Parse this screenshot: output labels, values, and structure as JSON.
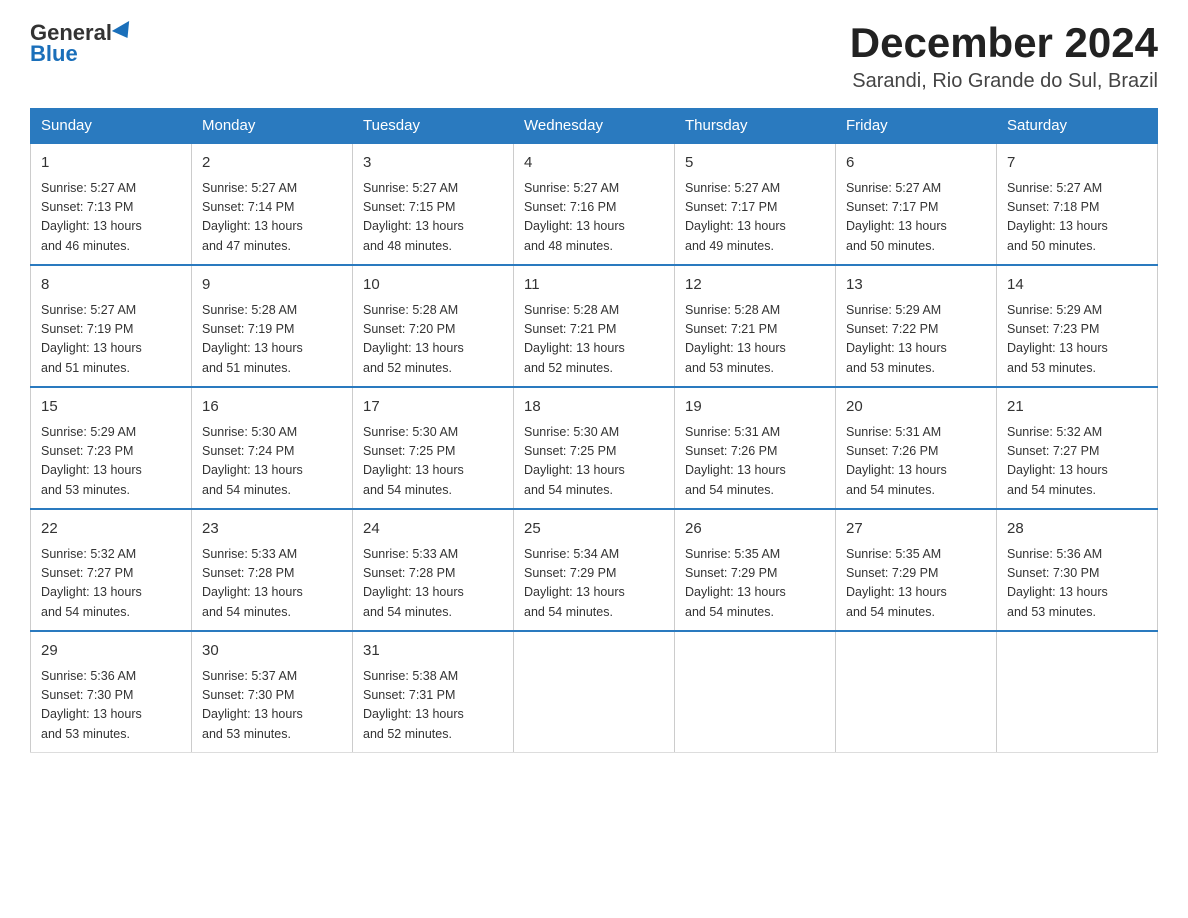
{
  "logo": {
    "general": "General",
    "blue": "Blue"
  },
  "title": "December 2024",
  "location": "Sarandi, Rio Grande do Sul, Brazil",
  "days_of_week": [
    "Sunday",
    "Monday",
    "Tuesday",
    "Wednesday",
    "Thursday",
    "Friday",
    "Saturday"
  ],
  "weeks": [
    [
      {
        "day": "1",
        "sunrise": "5:27 AM",
        "sunset": "7:13 PM",
        "daylight": "13 hours and 46 minutes."
      },
      {
        "day": "2",
        "sunrise": "5:27 AM",
        "sunset": "7:14 PM",
        "daylight": "13 hours and 47 minutes."
      },
      {
        "day": "3",
        "sunrise": "5:27 AM",
        "sunset": "7:15 PM",
        "daylight": "13 hours and 48 minutes."
      },
      {
        "day": "4",
        "sunrise": "5:27 AM",
        "sunset": "7:16 PM",
        "daylight": "13 hours and 48 minutes."
      },
      {
        "day": "5",
        "sunrise": "5:27 AM",
        "sunset": "7:17 PM",
        "daylight": "13 hours and 49 minutes."
      },
      {
        "day": "6",
        "sunrise": "5:27 AM",
        "sunset": "7:17 PM",
        "daylight": "13 hours and 50 minutes."
      },
      {
        "day": "7",
        "sunrise": "5:27 AM",
        "sunset": "7:18 PM",
        "daylight": "13 hours and 50 minutes."
      }
    ],
    [
      {
        "day": "8",
        "sunrise": "5:27 AM",
        "sunset": "7:19 PM",
        "daylight": "13 hours and 51 minutes."
      },
      {
        "day": "9",
        "sunrise": "5:28 AM",
        "sunset": "7:19 PM",
        "daylight": "13 hours and 51 minutes."
      },
      {
        "day": "10",
        "sunrise": "5:28 AM",
        "sunset": "7:20 PM",
        "daylight": "13 hours and 52 minutes."
      },
      {
        "day": "11",
        "sunrise": "5:28 AM",
        "sunset": "7:21 PM",
        "daylight": "13 hours and 52 minutes."
      },
      {
        "day": "12",
        "sunrise": "5:28 AM",
        "sunset": "7:21 PM",
        "daylight": "13 hours and 53 minutes."
      },
      {
        "day": "13",
        "sunrise": "5:29 AM",
        "sunset": "7:22 PM",
        "daylight": "13 hours and 53 minutes."
      },
      {
        "day": "14",
        "sunrise": "5:29 AM",
        "sunset": "7:23 PM",
        "daylight": "13 hours and 53 minutes."
      }
    ],
    [
      {
        "day": "15",
        "sunrise": "5:29 AM",
        "sunset": "7:23 PM",
        "daylight": "13 hours and 53 minutes."
      },
      {
        "day": "16",
        "sunrise": "5:30 AM",
        "sunset": "7:24 PM",
        "daylight": "13 hours and 54 minutes."
      },
      {
        "day": "17",
        "sunrise": "5:30 AM",
        "sunset": "7:25 PM",
        "daylight": "13 hours and 54 minutes."
      },
      {
        "day": "18",
        "sunrise": "5:30 AM",
        "sunset": "7:25 PM",
        "daylight": "13 hours and 54 minutes."
      },
      {
        "day": "19",
        "sunrise": "5:31 AM",
        "sunset": "7:26 PM",
        "daylight": "13 hours and 54 minutes."
      },
      {
        "day": "20",
        "sunrise": "5:31 AM",
        "sunset": "7:26 PM",
        "daylight": "13 hours and 54 minutes."
      },
      {
        "day": "21",
        "sunrise": "5:32 AM",
        "sunset": "7:27 PM",
        "daylight": "13 hours and 54 minutes."
      }
    ],
    [
      {
        "day": "22",
        "sunrise": "5:32 AM",
        "sunset": "7:27 PM",
        "daylight": "13 hours and 54 minutes."
      },
      {
        "day": "23",
        "sunrise": "5:33 AM",
        "sunset": "7:28 PM",
        "daylight": "13 hours and 54 minutes."
      },
      {
        "day": "24",
        "sunrise": "5:33 AM",
        "sunset": "7:28 PM",
        "daylight": "13 hours and 54 minutes."
      },
      {
        "day": "25",
        "sunrise": "5:34 AM",
        "sunset": "7:29 PM",
        "daylight": "13 hours and 54 minutes."
      },
      {
        "day": "26",
        "sunrise": "5:35 AM",
        "sunset": "7:29 PM",
        "daylight": "13 hours and 54 minutes."
      },
      {
        "day": "27",
        "sunrise": "5:35 AM",
        "sunset": "7:29 PM",
        "daylight": "13 hours and 54 minutes."
      },
      {
        "day": "28",
        "sunrise": "5:36 AM",
        "sunset": "7:30 PM",
        "daylight": "13 hours and 53 minutes."
      }
    ],
    [
      {
        "day": "29",
        "sunrise": "5:36 AM",
        "sunset": "7:30 PM",
        "daylight": "13 hours and 53 minutes."
      },
      {
        "day": "30",
        "sunrise": "5:37 AM",
        "sunset": "7:30 PM",
        "daylight": "13 hours and 53 minutes."
      },
      {
        "day": "31",
        "sunrise": "5:38 AM",
        "sunset": "7:31 PM",
        "daylight": "13 hours and 52 minutes."
      },
      null,
      null,
      null,
      null
    ]
  ],
  "labels": {
    "sunrise": "Sunrise:",
    "sunset": "Sunset:",
    "daylight": "Daylight:"
  }
}
